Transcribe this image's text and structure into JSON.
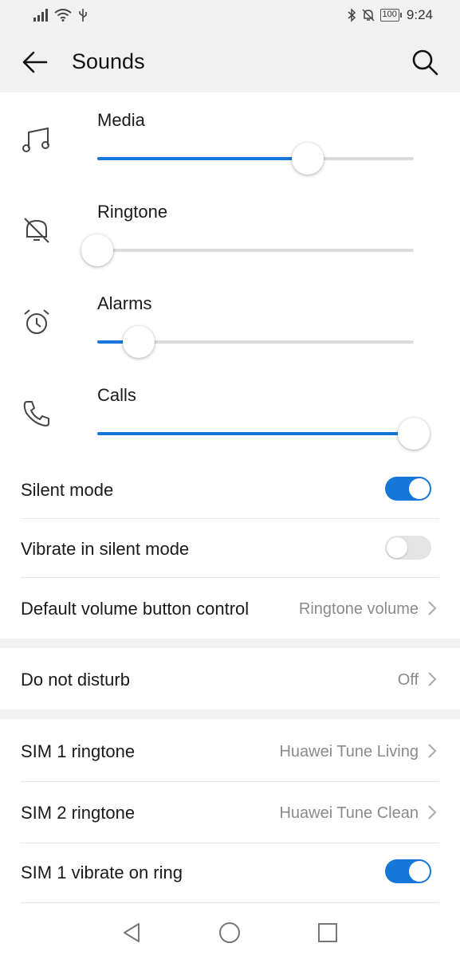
{
  "status_bar": {
    "time": "9:24",
    "battery": "100",
    "left_icons": [
      "signal-icon",
      "wifi-icon",
      "usb-icon"
    ],
    "right_icons": [
      "bluetooth-icon",
      "notifications-off-icon",
      "battery-icon"
    ]
  },
  "app_bar": {
    "title": "Sounds",
    "back_icon": "arrow-left-icon",
    "search_icon": "search-icon"
  },
  "volume": [
    {
      "label": "Media",
      "icon": "music-note-icon",
      "level": 0.665
    },
    {
      "label": "Ringtone",
      "icon": "bell-off-icon",
      "level": 0.0
    },
    {
      "label": "Alarms",
      "icon": "alarm-clock-icon",
      "level": 0.13
    },
    {
      "label": "Calls",
      "icon": "phone-icon",
      "level": 1.0
    }
  ],
  "settings": {
    "silent_mode": {
      "label": "Silent mode",
      "on": true
    },
    "vibrate_silent": {
      "label": "Vibrate in silent mode",
      "on": false
    },
    "volume_button": {
      "label": "Default volume button control",
      "value": "Ringtone volume"
    },
    "do_not_disturb": {
      "label": "Do not disturb",
      "value": "Off"
    },
    "sim1_ringtone": {
      "label": "SIM 1 ringtone",
      "value": "Huawei Tune Living"
    },
    "sim2_ringtone": {
      "label": "SIM 2 ringtone",
      "value": "Huawei Tune Clean"
    },
    "sim1_vibrate": {
      "label": "SIM 1 vibrate on ring",
      "on": true
    }
  },
  "colors": {
    "accent": "#1677d8",
    "background": "#ffffff",
    "header": "#f1f1f1",
    "secondary_text": "#8a8a8a"
  },
  "nav_bar": [
    "back-triangle-icon",
    "home-circle-icon",
    "recents-square-icon"
  ]
}
